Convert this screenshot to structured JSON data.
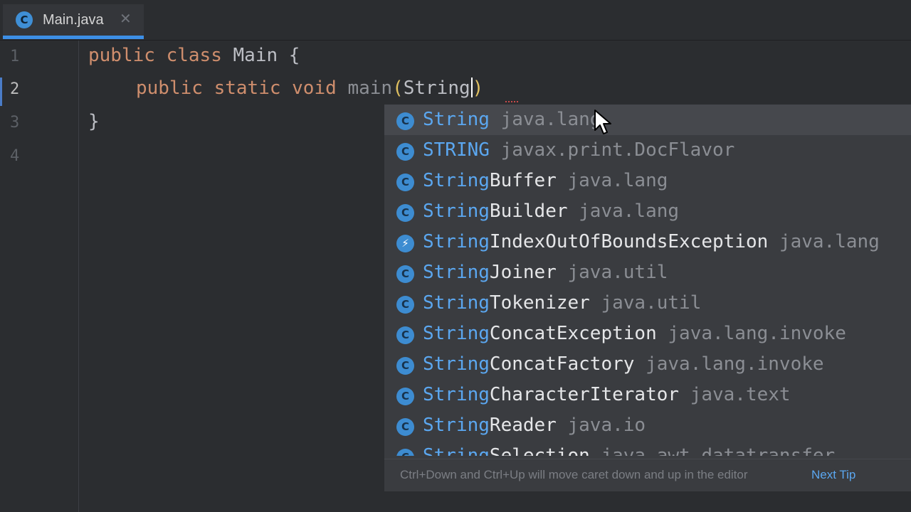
{
  "tab": {
    "icon_letter": "C",
    "title": "Main.java",
    "close": "✕"
  },
  "gutter": {
    "lines": [
      "1",
      "2",
      "3",
      "4"
    ]
  },
  "code": {
    "line1": {
      "kw1": "public",
      "kw2": "class",
      "name": "Main",
      "brace": "{"
    },
    "line2": {
      "kw1": "public",
      "kw2": "static",
      "kw3": "void",
      "fn": "main",
      "open": "(",
      "arg": "String",
      "close": ")"
    },
    "line3": {
      "brace": "}"
    }
  },
  "completion": {
    "items": [
      {
        "match": "String",
        "rest": "",
        "pkg": "java.lang",
        "icon": "C"
      },
      {
        "match": "STRING",
        "rest": "",
        "pkg": "javax.print.DocFlavor",
        "icon": "C"
      },
      {
        "match": "String",
        "rest": "Buffer",
        "pkg": "java.lang",
        "icon": "C"
      },
      {
        "match": "String",
        "rest": "Builder",
        "pkg": "java.lang",
        "icon": "C"
      },
      {
        "match": "String",
        "rest": "IndexOutOfBoundsException",
        "pkg": "java.lang",
        "icon": "⚡"
      },
      {
        "match": "String",
        "rest": "Joiner",
        "pkg": "java.util",
        "icon": "C"
      },
      {
        "match": "String",
        "rest": "Tokenizer",
        "pkg": "java.util",
        "icon": "C"
      },
      {
        "match": "String",
        "rest": "ConcatException",
        "pkg": "java.lang.invoke",
        "icon": "C"
      },
      {
        "match": "String",
        "rest": "ConcatFactory",
        "pkg": "java.lang.invoke",
        "icon": "C"
      },
      {
        "match": "String",
        "rest": "CharacterIterator",
        "pkg": "java.text",
        "icon": "C"
      },
      {
        "match": "String",
        "rest": "Reader",
        "pkg": "java.io",
        "icon": "C"
      },
      {
        "match": "String",
        "rest": "Selection",
        "pkg": "java.awt.datatransfer",
        "icon": "C"
      }
    ],
    "hint_text": "Ctrl+Down and Ctrl+Up will move caret down and up in the editor",
    "hint_link": "Next Tip"
  },
  "colors": {
    "accent": "#3d8fe6",
    "keyword": "#cf8e6d",
    "match": "#5ba7f0",
    "background": "#2b2d30",
    "popup": "#3a3c40"
  }
}
